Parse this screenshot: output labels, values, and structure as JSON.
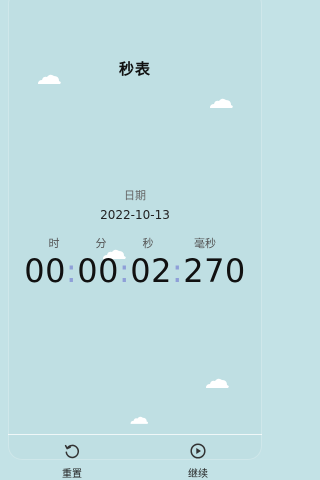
{
  "header": {
    "title": "秒表"
  },
  "date": {
    "label": "日期",
    "value": "2022-10-13"
  },
  "units": {
    "hour": "时",
    "minute": "分",
    "second": "秒",
    "millisecond": "毫秒"
  },
  "timer": {
    "hours": "00",
    "minutes": "00",
    "seconds": "02",
    "milliseconds": "270",
    "separator": ":"
  },
  "bottom_bar": {
    "reset_label": "重置",
    "continue_label": "继续",
    "reset_icon": "reset-icon",
    "continue_icon": "play-circle-icon"
  },
  "colors": {
    "background": "#c3e2e6",
    "separator_accent": "#8f9fd8"
  }
}
